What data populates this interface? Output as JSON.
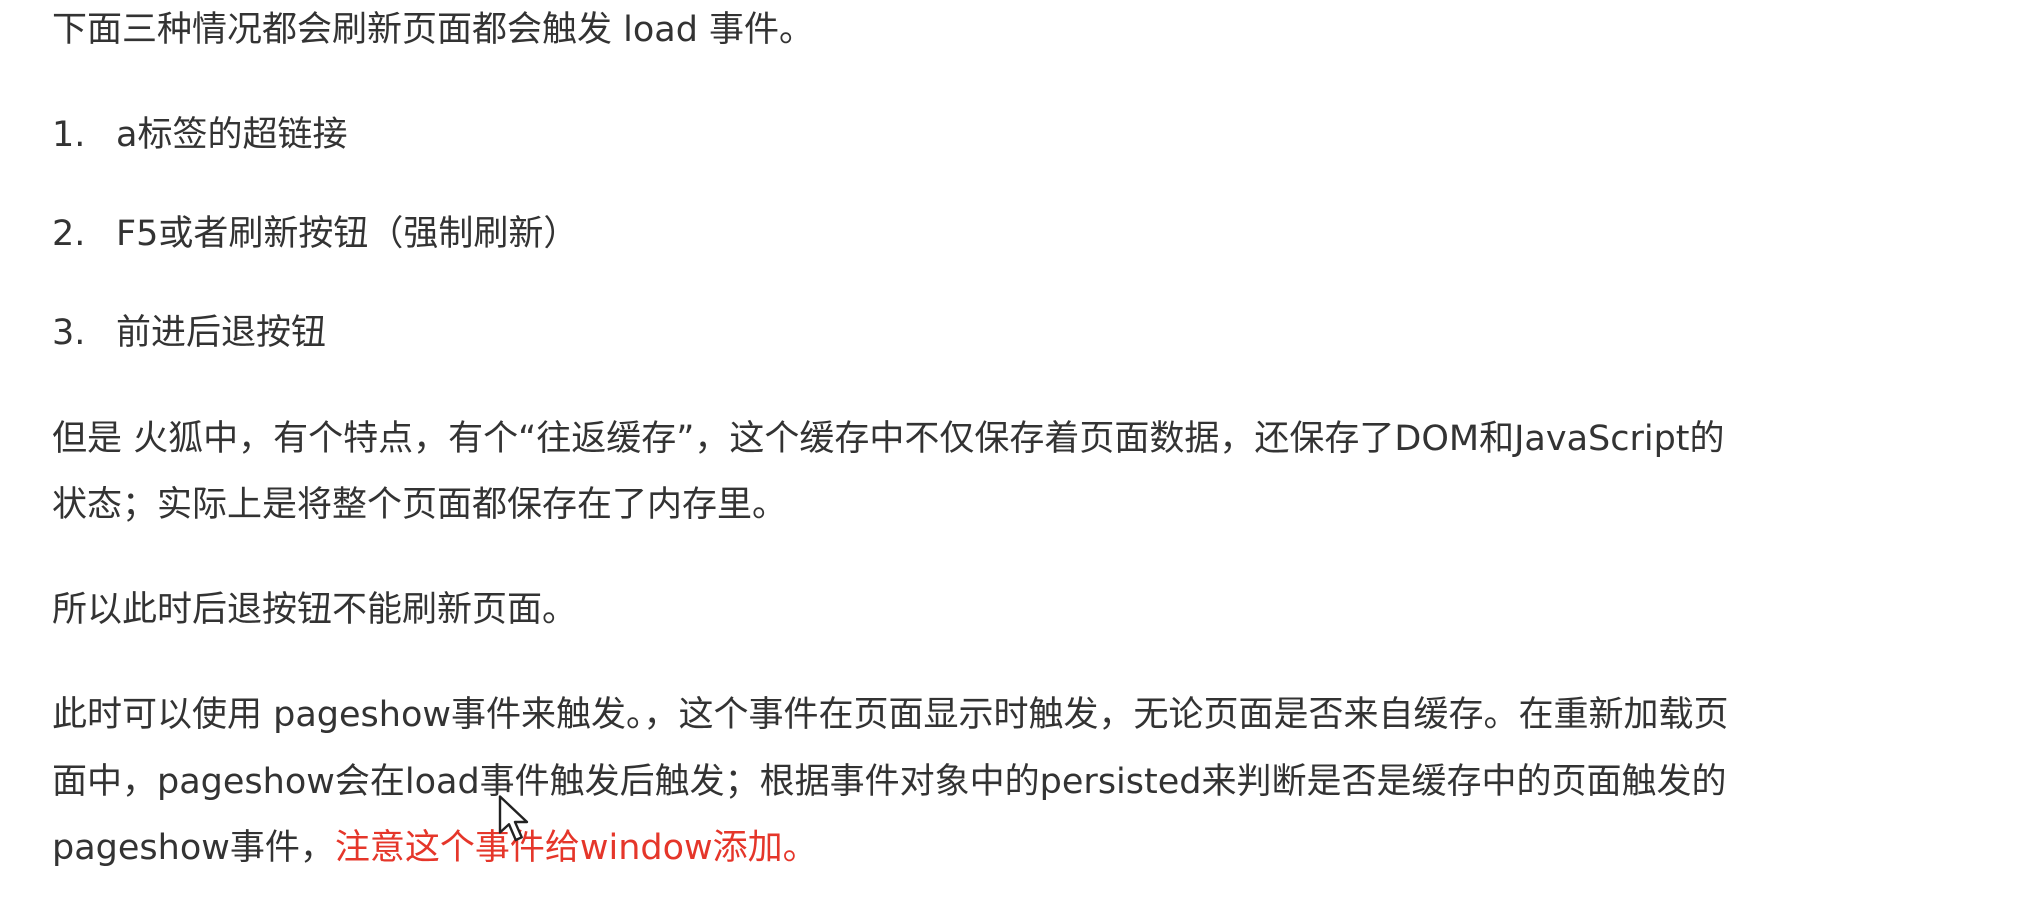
{
  "intro": "下面三种情况都会刷新页面都会触发 load 事件。",
  "list": [
    {
      "num": "1.",
      "text": "a标签的超链接"
    },
    {
      "num": "2.",
      "text": "F5或者刷新按钮（强制刷新）"
    },
    {
      "num": "3.",
      "text": "前进后退按钮"
    }
  ],
  "para1": {
    "line1": "但是 火狐中，有个特点，有个“往返缓存”，这个缓存中不仅保存着页面数据，还保存了DOM和JavaScript的",
    "line2": "状态；实际上是将整个页面都保存在了内存里。"
  },
  "para2": "所以此时后退按钮不能刷新页面。",
  "para3": {
    "line1": "此时可以使用 pageshow事件来触发。，这个事件在页面显示时触发，无论页面是否来自缓存。在重新加载页",
    "line2": "面中，pageshow会在load事件触发后触发；根据事件对象中的persisted来判断是否是缓存中的页面触发的",
    "line3_plain": "pageshow事件，",
    "line3_highlight": "注意这个事件给window添加。"
  },
  "colors": {
    "text": "#333333",
    "highlight": "#e5362a"
  },
  "icons": {
    "cursor": "mouse-pointer-icon"
  }
}
